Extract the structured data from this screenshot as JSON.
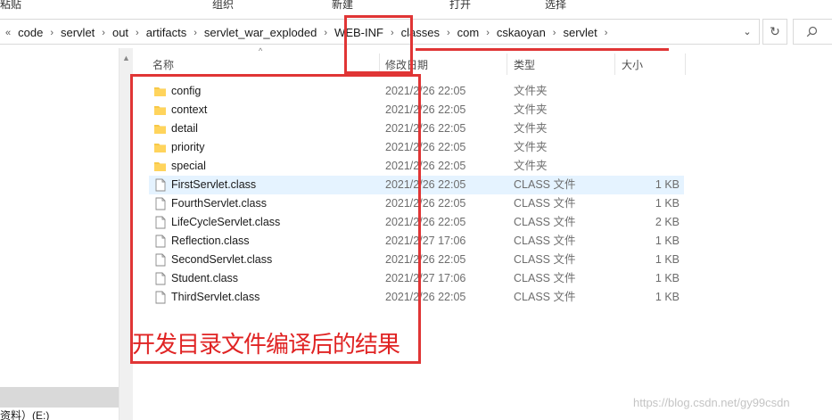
{
  "ribbon": {
    "labels": [
      "粘贴",
      "组织",
      "新建",
      "打开",
      "选择"
    ]
  },
  "address": {
    "segments": [
      "code",
      "servlet",
      "out",
      "artifacts",
      "servlet_war_exploded",
      "WEB-INF",
      "classes",
      "com",
      "cskaoyan",
      "servlet"
    ]
  },
  "columns": {
    "name": "名称",
    "date": "修改日期",
    "type": "类型",
    "size": "大小"
  },
  "files": [
    {
      "name": "config",
      "date": "2021/2/26 22:05",
      "type": "文件夹",
      "size": "",
      "kind": "folder"
    },
    {
      "name": "context",
      "date": "2021/2/26 22:05",
      "type": "文件夹",
      "size": "",
      "kind": "folder"
    },
    {
      "name": "detail",
      "date": "2021/2/26 22:05",
      "type": "文件夹",
      "size": "",
      "kind": "folder"
    },
    {
      "name": "priority",
      "date": "2021/2/26 22:05",
      "type": "文件夹",
      "size": "",
      "kind": "folder"
    },
    {
      "name": "special",
      "date": "2021/2/26 22:05",
      "type": "文件夹",
      "size": "",
      "kind": "folder"
    },
    {
      "name": "FirstServlet.class",
      "date": "2021/2/26 22:05",
      "type": "CLASS 文件",
      "size": "1 KB",
      "kind": "file",
      "highlighted": true
    },
    {
      "name": "FourthServlet.class",
      "date": "2021/2/26 22:05",
      "type": "CLASS 文件",
      "size": "1 KB",
      "kind": "file"
    },
    {
      "name": "LifeCycleServlet.class",
      "date": "2021/2/26 22:05",
      "type": "CLASS 文件",
      "size": "2 KB",
      "kind": "file"
    },
    {
      "name": "Reflection.class",
      "date": "2021/2/27 17:06",
      "type": "CLASS 文件",
      "size": "1 KB",
      "kind": "file"
    },
    {
      "name": "SecondServlet.class",
      "date": "2021/2/26 22:05",
      "type": "CLASS 文件",
      "size": "1 KB",
      "kind": "file"
    },
    {
      "name": "Student.class",
      "date": "2021/2/27 17:06",
      "type": "CLASS 文件",
      "size": "1 KB",
      "kind": "file"
    },
    {
      "name": "ThirdServlet.class",
      "date": "2021/2/26 22:05",
      "type": "CLASS 文件",
      "size": "1 KB",
      "kind": "file"
    }
  ],
  "nav": {
    "bottom_item": "资料）(E:)"
  },
  "annotation": {
    "caption": "开发目录文件编译后的结果",
    "color": "#e03535"
  },
  "watermark": "https://blog.csdn.net/gy99csdn",
  "colors": {
    "folder": "#f7c948",
    "selection": "#e5f3ff"
  }
}
